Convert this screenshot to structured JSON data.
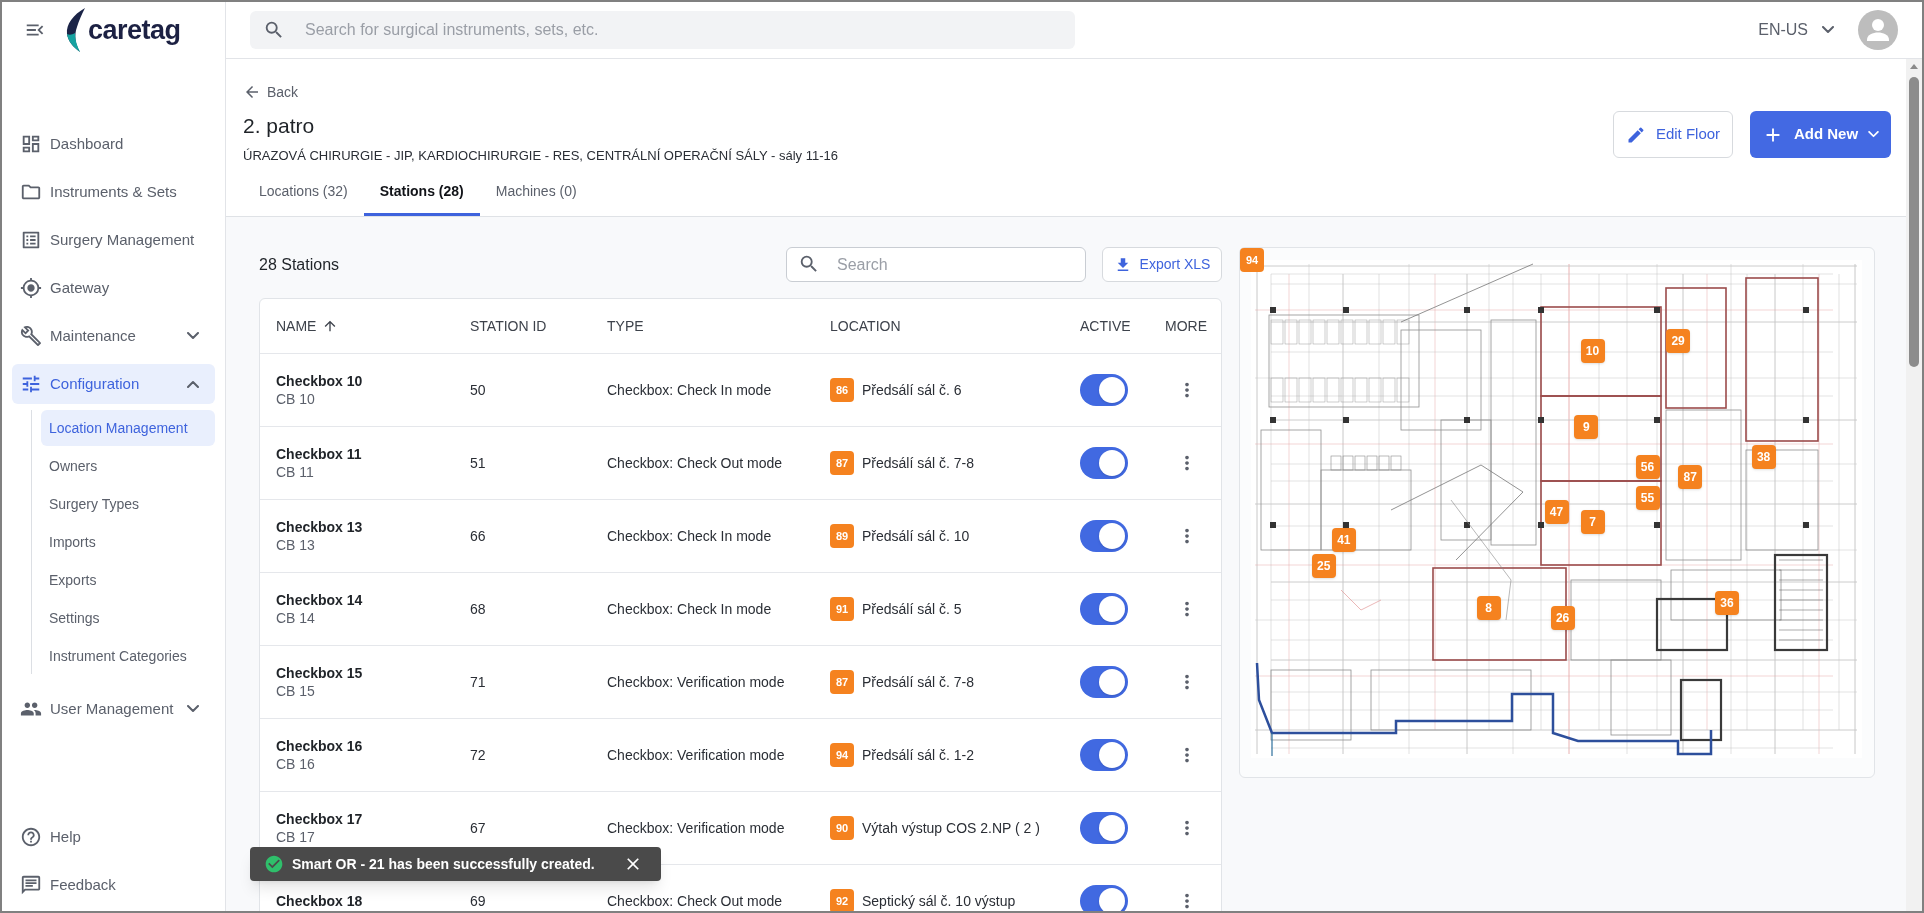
{
  "sidebar": {
    "logo_text": "caretag",
    "items": [
      {
        "label": "Dashboard",
        "selected": false
      },
      {
        "label": "Instruments & Sets",
        "selected": false
      },
      {
        "label": "Surgery Management",
        "selected": false
      },
      {
        "label": "Gateway",
        "selected": false
      },
      {
        "label": "Maintenance",
        "selected": false,
        "expanded": false
      },
      {
        "label": "Configuration",
        "selected": true,
        "expanded": true,
        "children": [
          {
            "label": "Location Management",
            "selected": true
          },
          {
            "label": "Owners",
            "selected": false
          },
          {
            "label": "Surgery Types",
            "selected": false
          },
          {
            "label": "Imports",
            "selected": false
          },
          {
            "label": "Exports",
            "selected": false
          },
          {
            "label": "Settings",
            "selected": false
          },
          {
            "label": "Instrument Categories",
            "selected": false
          }
        ]
      },
      {
        "label": "User Management",
        "selected": false,
        "expanded": false
      }
    ],
    "footer_items": [
      {
        "label": "Help"
      },
      {
        "label": "Feedback"
      }
    ]
  },
  "header": {
    "search": {
      "placeholder": "Search for surgical instruments, sets, etc."
    },
    "language": "EN-US"
  },
  "page": {
    "back": "Back",
    "title": "2. patro",
    "subtitle": "ÚRAZOVÁ CHIRURGIE - JIP, KARDIOCHIRURGIE - RES, CENTRÁLNÍ OPERAČNÍ SÁLY - sály 11-16",
    "edit_button": "Edit Floor",
    "add_button": "Add New",
    "tabs": [
      {
        "label": "Locations (32)",
        "selected": false
      },
      {
        "label": "Stations (28)",
        "selected": true
      },
      {
        "label": "Machines (0)",
        "selected": false
      }
    ]
  },
  "stations": {
    "count": "28 Stations",
    "search": {
      "placeholder": "Search"
    },
    "export_button": "Export XLS",
    "columns": [
      {
        "label": "NAME",
        "sorted": true
      },
      {
        "label": "STATION ID",
        "sorted": false
      },
      {
        "label": "TYPE",
        "sorted": false
      },
      {
        "label": "LOCATION",
        "sorted": false
      },
      {
        "label": "ACTIVE",
        "sorted": false
      },
      {
        "label": "MORE",
        "sorted": false
      }
    ],
    "rows": [
      {
        "name": "Checkbox 10",
        "code": "CB 10",
        "station_id": "50",
        "type": "Checkbox: Check In mode",
        "location_code": "86",
        "location": "Předsálí sál č. 6",
        "active": true
      },
      {
        "name": "Checkbox 11",
        "code": "CB 11",
        "station_id": "51",
        "type": "Checkbox: Check Out mode",
        "location_code": "87",
        "location": "Předsálí sál č. 7-8",
        "active": true
      },
      {
        "name": "Checkbox 13",
        "code": "CB 13",
        "station_id": "66",
        "type": "Checkbox: Check In mode",
        "location_code": "89",
        "location": "Předsálí sál č. 10",
        "active": true
      },
      {
        "name": "Checkbox 14",
        "code": "CB 14",
        "station_id": "68",
        "type": "Checkbox: Check In mode",
        "location_code": "91",
        "location": "Předsálí sál č. 5",
        "active": true
      },
      {
        "name": "Checkbox 15",
        "code": "CB 15",
        "station_id": "71",
        "type": "Checkbox: Verification mode",
        "location_code": "87",
        "location": "Předsálí sál č. 7-8",
        "active": true
      },
      {
        "name": "Checkbox 16",
        "code": "CB 16",
        "station_id": "72",
        "type": "Checkbox: Verification mode",
        "location_code": "94",
        "location": "Předsálí sál č. 1-2",
        "active": true
      },
      {
        "name": "Checkbox 17",
        "code": "CB 17",
        "station_id": "67",
        "type": "Checkbox: Verification mode",
        "location_code": "90",
        "location": "Výtah výstup COS 2.NP ( 2 )",
        "active": true
      },
      {
        "name": "Checkbox 18",
        "station_id": "69",
        "type": "Checkbox: Check Out mode",
        "location_code": "92",
        "location": "Septický sál č. 10 výstup",
        "active": true
      }
    ]
  },
  "map": {
    "floor_badge": "94",
    "pins": [
      {
        "label": "29"
      },
      {
        "label": "10"
      },
      {
        "label": "9"
      },
      {
        "label": "38"
      },
      {
        "label": "56"
      },
      {
        "label": "87"
      },
      {
        "label": "55"
      },
      {
        "label": "47"
      },
      {
        "label": "7"
      },
      {
        "label": "41"
      },
      {
        "label": "25"
      },
      {
        "label": "36"
      },
      {
        "label": "8"
      },
      {
        "label": "26"
      }
    ]
  },
  "toast": {
    "message": "Smart OR - 21 has been successfully created."
  }
}
